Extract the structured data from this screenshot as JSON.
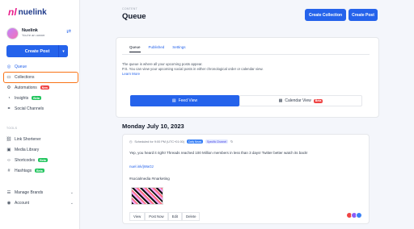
{
  "brand": {
    "mark": "nl",
    "name": "nuelink"
  },
  "profile": {
    "name": "Nuelink",
    "role": "You're an owner"
  },
  "sidebar": {
    "create_post": "Create Post",
    "items": [
      {
        "label": "Queue",
        "icon": "queue-icon",
        "active": true
      },
      {
        "label": "Collections",
        "icon": "folder-icon"
      },
      {
        "label": "Automations",
        "icon": "automation-icon",
        "badge": "New"
      },
      {
        "label": "Insights",
        "icon": "insights-icon",
        "badge": "Beta"
      },
      {
        "label": "Social Channels",
        "icon": "channels-icon"
      }
    ],
    "tools_label": "TOOLS",
    "tools": [
      {
        "label": "Link Shortener",
        "icon": "link-icon"
      },
      {
        "label": "Media Library",
        "icon": "media-icon"
      },
      {
        "label": "Shortcodes",
        "icon": "code-icon",
        "badge": "Beta"
      },
      {
        "label": "Hashtags",
        "icon": "hashtag-icon",
        "badge": "Beta"
      }
    ],
    "bottom": [
      {
        "label": "Manage Brands",
        "icon": "brands-icon"
      },
      {
        "label": "Account",
        "icon": "account-icon"
      }
    ]
  },
  "header": {
    "section": "CONTENT",
    "title": "Queue",
    "create_collection": "Create Collection",
    "create_post": "Create Post"
  },
  "tabs": [
    "Queue",
    "Published",
    "Settings"
  ],
  "info": {
    "line1": "The queue is where all your upcoming posts appear.",
    "line2": "P.S. You can view your upcoming social posts in either chronological order or calendar view.",
    "learn_more": "Learn More"
  },
  "view_toggle": {
    "feed": "Feed View",
    "calendar": "Calendar View",
    "calendar_badge": "Beta"
  },
  "date_heading": "Monday July 10, 2023",
  "post": {
    "scheduled": "Scheduled for 9:00 PM (UTC+01:00)",
    "chip_daily": "Daily News",
    "chip_slot": "Specific Channel",
    "text": "Yep, you heard it right! Threads reached 100 Million members in less than 3 days! Twitter better watch its back!",
    "link": "nuel.ink/jWaGz",
    "tags": "#socialmedia #marketing",
    "actions": [
      "View",
      "Post Now",
      "Edit",
      "Delete"
    ]
  },
  "colors": {
    "accent": "#2563eb",
    "highlight": "#f97316",
    "brand_pink": "#e91e8c"
  }
}
